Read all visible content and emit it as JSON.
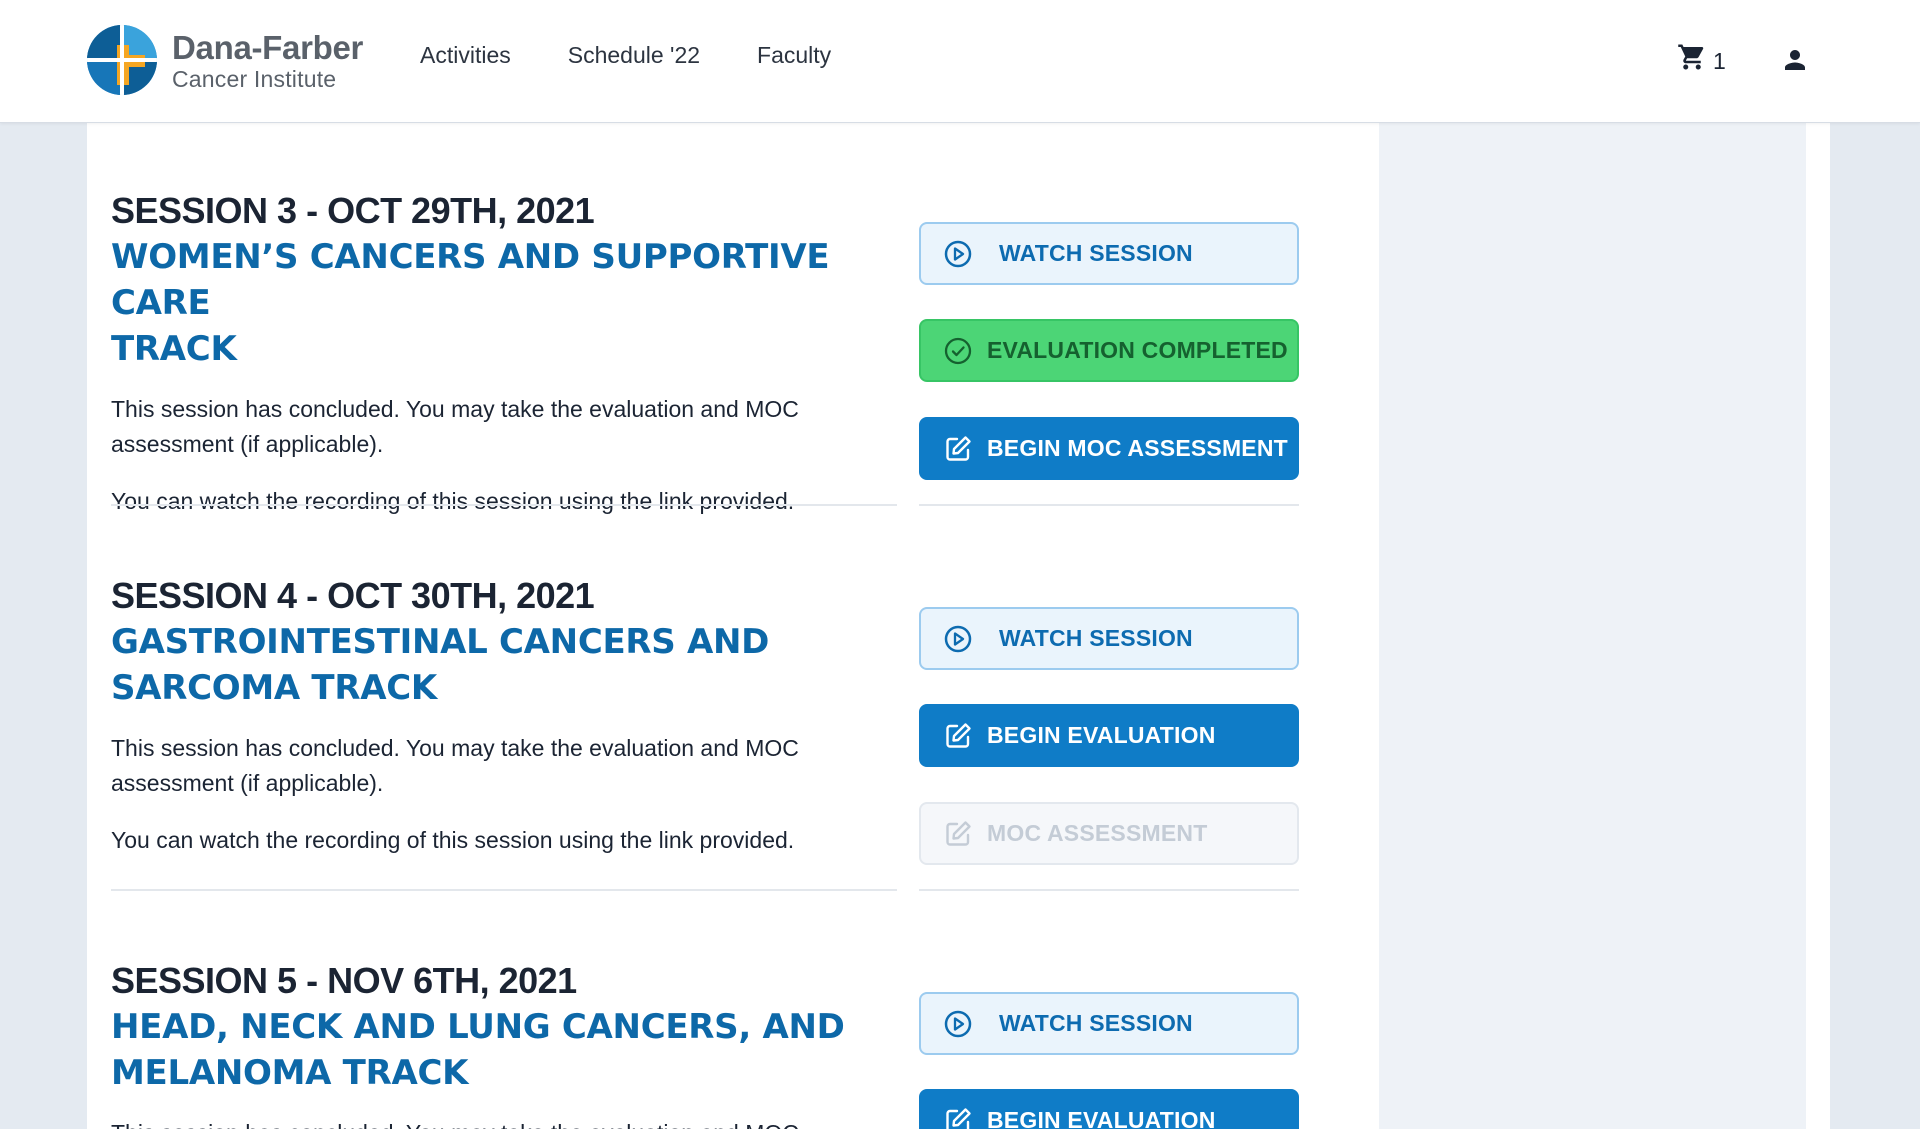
{
  "header": {
    "logo_name": "Dana-Farber",
    "logo_sub": "Cancer Institute",
    "nav": [
      "Activities",
      "Schedule '22",
      "Faculty"
    ],
    "cart_count": "1"
  },
  "sessions": [
    {
      "date": "SESSION 3 - OCT 29TH, 2021",
      "track_line1": "WOMEN’S CANCERS AND SUPPORTIVE CARE",
      "track_line2": "TRACK",
      "desc_line1": "This session has concluded. You may take the evaluation and MOC",
      "desc_line2": "assessment (if applicable).",
      "desc2": "You can watch the recording of this session using the link provided.",
      "buttons": [
        "WATCH SESSION",
        "EVALUATION COMPLETED",
        "BEGIN MOC ASSESSMENT"
      ]
    },
    {
      "date": "SESSION 4 - OCT 30TH, 2021",
      "track_line1": "GASTROINTESTINAL CANCERS AND",
      "track_line2": "SARCOMA TRACK",
      "desc_line1": "This session has concluded. You may take the evaluation and MOC",
      "desc_line2": "assessment (if applicable).",
      "desc2": "You can watch the recording of this session using the link provided.",
      "buttons": [
        "WATCH SESSION",
        "BEGIN EVALUATION",
        "MOC ASSESSMENT"
      ]
    },
    {
      "date": "SESSION 5 - NOV 6TH, 2021",
      "track_line1": "HEAD, NECK AND LUNG CANCERS, AND",
      "track_line2": "MELANOMA TRACK",
      "desc_line1": "This session has concluded. You may take the evaluation and MOC",
      "buttons": [
        "WATCH SESSION",
        "BEGIN EVALUATION"
      ]
    }
  ]
}
